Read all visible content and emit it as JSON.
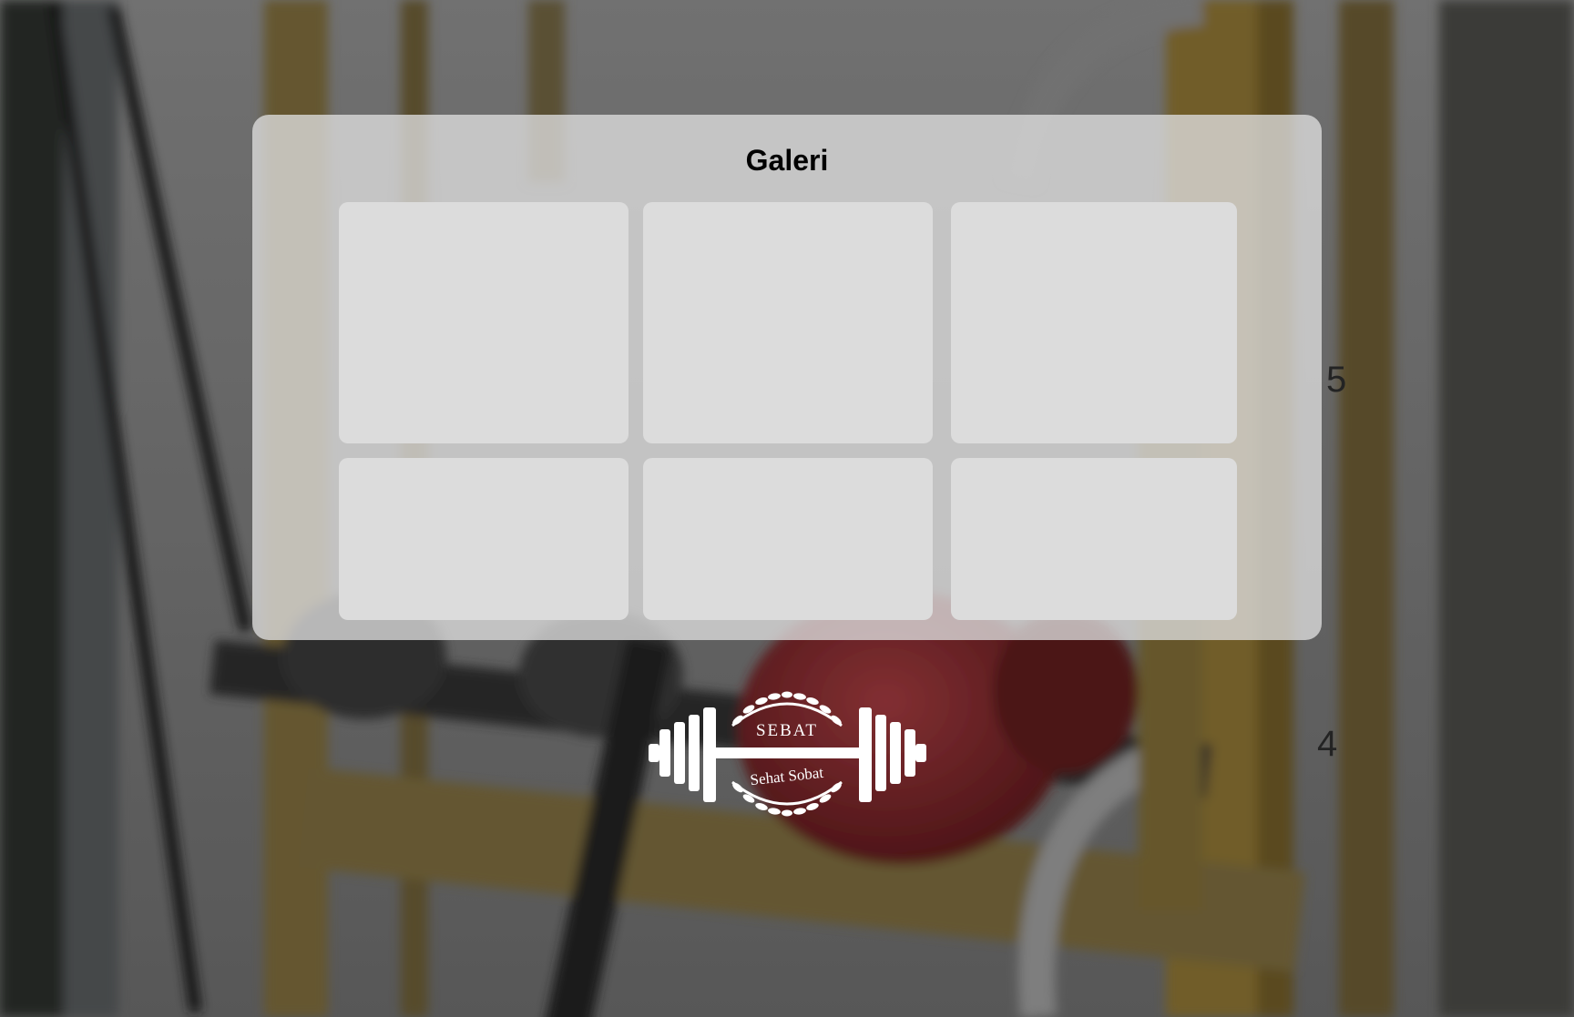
{
  "page": {
    "title": "Galeri"
  },
  "gallery": {
    "tiles": [
      {
        "label": ""
      },
      {
        "label": ""
      },
      {
        "label": ""
      },
      {
        "label": ""
      },
      {
        "label": ""
      },
      {
        "label": ""
      }
    ]
  },
  "logo": {
    "top_text": "SEBAT",
    "bottom_text": "Sehat Sobat"
  },
  "colors": {
    "panel": "#dedede",
    "tile": "#dcdcdc",
    "title": "#000000",
    "logo": "#ffffff"
  },
  "icons": {
    "logo": "barbell-laurel-icon"
  }
}
